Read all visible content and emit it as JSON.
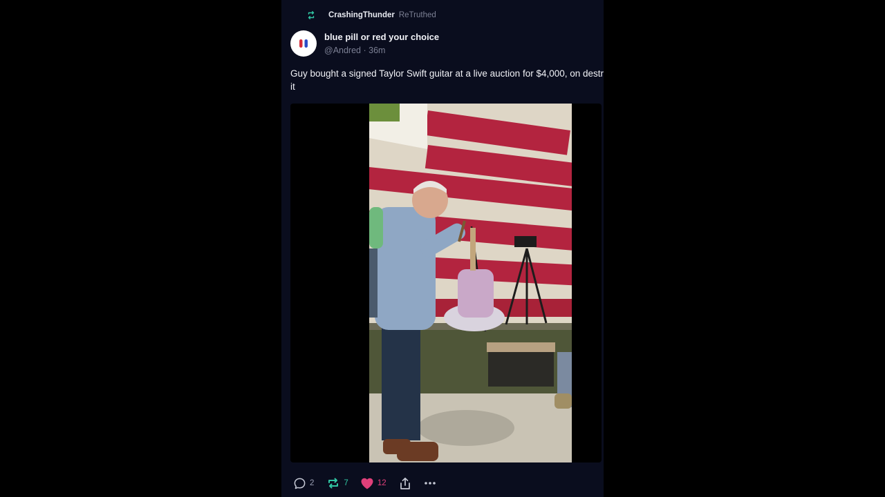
{
  "retruth": {
    "username": "CrashingThunder",
    "suffix": "ReTruthed"
  },
  "post": {
    "display_name": "blue pill or red your choice",
    "handle": "@Andred",
    "separator": "·",
    "time": "36m",
    "text": "Guy bought a signed Taylor Swift guitar at a live auction for $4,000, on destroy it"
  },
  "actions": {
    "replies": "2",
    "retruths": "7",
    "likes": "12"
  },
  "colors": {
    "background": "#0a0d1e",
    "retruth_accent": "#31c7a4",
    "like_accent": "#e0407a",
    "muted_text": "#7c8094"
  },
  "icons": [
    "retruth-icon",
    "reply-icon",
    "heart-icon",
    "share-icon",
    "more-icon"
  ]
}
